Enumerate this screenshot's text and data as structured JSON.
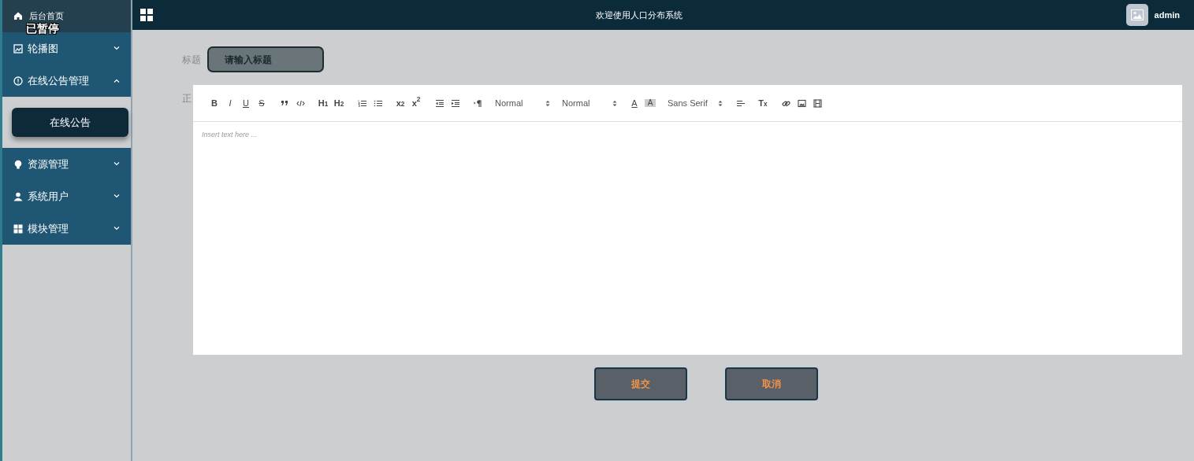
{
  "overlay_label": "已暂停",
  "sidebar": {
    "items": [
      {
        "kind": "home",
        "label": "后台首页"
      },
      {
        "kind": "picture",
        "label": "轮播图",
        "expanded": false
      },
      {
        "kind": "notice",
        "label": "在线公告管理",
        "expanded": true,
        "children": [
          {
            "label": "在线公告",
            "selected": true
          }
        ]
      },
      {
        "kind": "bulb",
        "label": "资源管理",
        "expanded": false
      },
      {
        "kind": "user",
        "label": "系统用户",
        "expanded": false
      },
      {
        "kind": "grid",
        "label": "模块管理",
        "expanded": false
      }
    ]
  },
  "header": {
    "title": "欢迎使用人口分布系统",
    "user": "admin"
  },
  "form": {
    "title_label": "标题",
    "title_placeholder": "请输入标题",
    "body_label": "正",
    "toolbar": [
      [
        {
          "kind": "bold",
          "label": "B"
        },
        {
          "kind": "italic",
          "label": "I"
        },
        {
          "kind": "underline",
          "label": "U"
        },
        {
          "kind": "strike",
          "label": "S"
        }
      ],
      [
        {
          "kind": "quote"
        },
        {
          "kind": "code"
        }
      ],
      [
        {
          "kind": "text",
          "label": "H$_{1}$"
        },
        {
          "kind": "text",
          "label": "H$_{2}$"
        }
      ],
      [
        {
          "kind": "ordered-list"
        },
        {
          "kind": "bullet-list"
        }
      ],
      [
        {
          "kind": "text",
          "label": "x$_{2}$"
        },
        {
          "kind": "text",
          "label": "x$^{2}$"
        }
      ],
      [
        {
          "kind": "outdent"
        },
        {
          "kind": "indent"
        }
      ],
      [
        {
          "kind": "direction"
        }
      ],
      [
        {
          "kind": "picker",
          "label": "Normal"
        }
      ],
      [
        {
          "kind": "picker",
          "label": "Normal"
        }
      ],
      [
        {
          "kind": "color",
          "label": "A"
        },
        {
          "kind": "background",
          "label": "A"
        }
      ],
      [
        {
          "kind": "picker",
          "label": "Sans Serif"
        }
      ],
      [
        {
          "kind": "align"
        }
      ],
      [
        {
          "kind": "text",
          "label": "T$_{x}$"
        }
      ],
      [
        {
          "kind": "link"
        },
        {
          "kind": "image"
        },
        {
          "kind": "video"
        }
      ]
    ],
    "editor_placeholder": "Insert text here ...",
    "buttons": [
      "提交",
      "取消"
    ]
  }
}
